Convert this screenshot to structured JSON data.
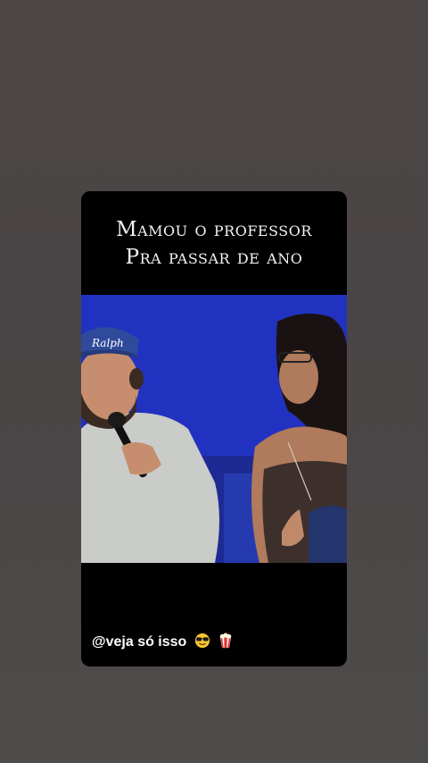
{
  "story": {
    "caption_line1": "Mamou o professor",
    "caption_line2": "Pra passar de ano",
    "cap_text": "Ralph",
    "bottom_text": "@veja só isso",
    "icons": [
      "sunglasses-face-icon",
      "popcorn-icon"
    ]
  },
  "colors": {
    "background": "#4b4646",
    "card": "#000000",
    "stage_blue": "#2434c8",
    "caption_text": "#f2f2f2"
  }
}
